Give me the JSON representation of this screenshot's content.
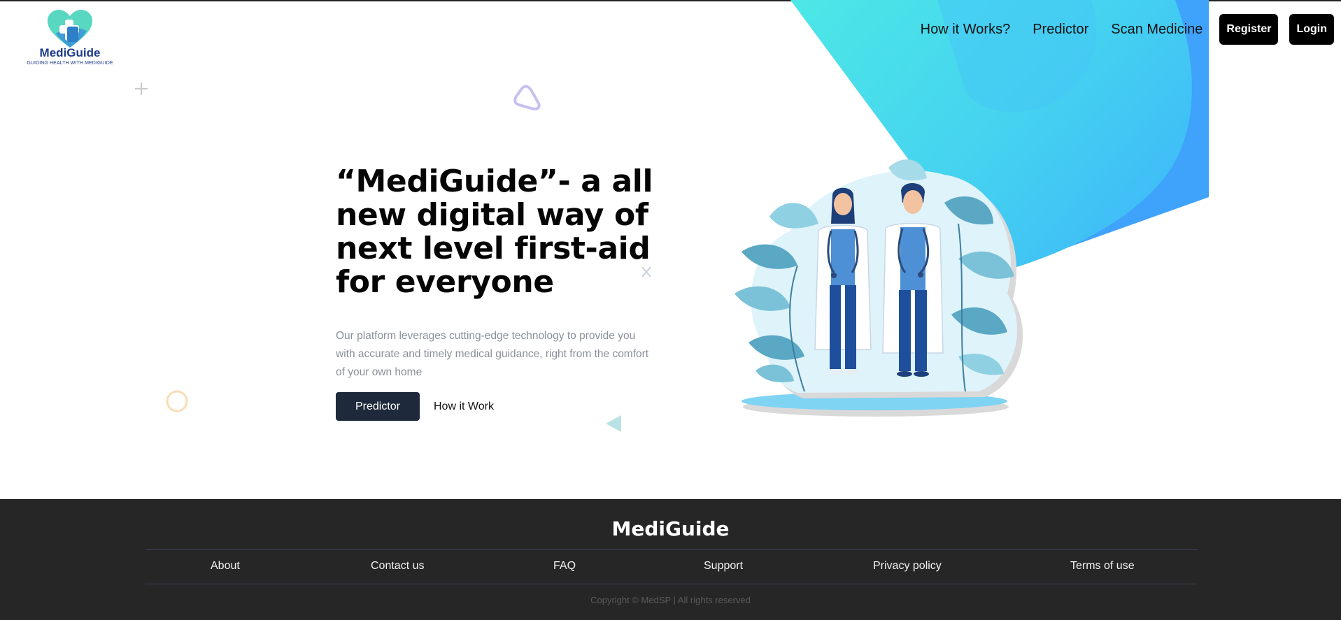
{
  "brand": {
    "name": "MediGuide",
    "tagline": "GUIDING HEALTH WITH MEDIGUIDE"
  },
  "nav": {
    "links": [
      "How it Works?",
      "Predictor",
      "Scan Medicine"
    ],
    "register_label": "Register",
    "login_label": "Login"
  },
  "hero": {
    "headline": "“MediGuide”- a all new digital way of next level first-aid for everyone",
    "description": "Our platform leverages cutting-edge technology to provide you with accurate and timely medical guidance, right from the comfort of your own home",
    "primary_button": "Predictor",
    "secondary_button": "How it Work"
  },
  "footer": {
    "brand": "MediGuide",
    "links": [
      "About",
      "Contact us",
      "FAQ",
      "Support",
      "Privacy policy",
      "Terms of use"
    ],
    "copyright": "Copyright © MedSP | All rights reserved"
  },
  "colors": {
    "accent_cyan": "#49e0e8",
    "accent_blue": "#3fa2fb",
    "button_dark": "#1e293b",
    "footer_bg": "#262626",
    "logo_blue": "#1f3b8a"
  }
}
